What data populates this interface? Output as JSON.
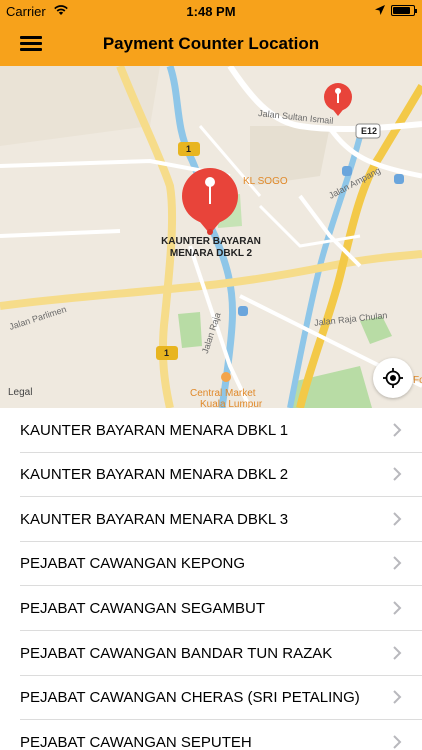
{
  "status": {
    "carrier": "Carrier",
    "time": "1:48 PM"
  },
  "nav": {
    "title": "Payment Counter Location"
  },
  "map": {
    "labels": {
      "jalan_sultan_ismail": "Jalan Sultan Ismail",
      "e12": "E12",
      "kl_sogo": "KL SOGO",
      "jalan_ampang": "Jalan Ampang",
      "route1_top": "1",
      "route1_bottom": "1",
      "jalan_parlimen": "Jalan Parlimen",
      "jalan_raja": "Jalan Raja",
      "jalan_raja_chulan": "Jalan Raja Chulan",
      "central_market_1": "Central Market",
      "central_market_2": "Kuala Lumpur",
      "fo": "Fo"
    },
    "pin_caption_line1": "KAUNTER BAYARAN",
    "pin_caption_line2": "MENARA DBKL 2",
    "legal": "Legal"
  },
  "list": [
    "KAUNTER BAYARAN MENARA DBKL 1",
    "KAUNTER BAYARAN MENARA DBKL 2",
    "KAUNTER BAYARAN MENARA DBKL 3",
    "PEJABAT CAWANGAN KEPONG",
    "PEJABAT CAWANGAN SEGAMBUT",
    "PEJABAT CAWANGAN BANDAR TUN RAZAK",
    "PEJABAT CAWANGAN CHERAS (SRI PETALING)",
    "PEJABAT CAWANGAN SEPUTEH"
  ],
  "colors": {
    "brand": "#f7a21b",
    "pin": "#e8443a"
  }
}
